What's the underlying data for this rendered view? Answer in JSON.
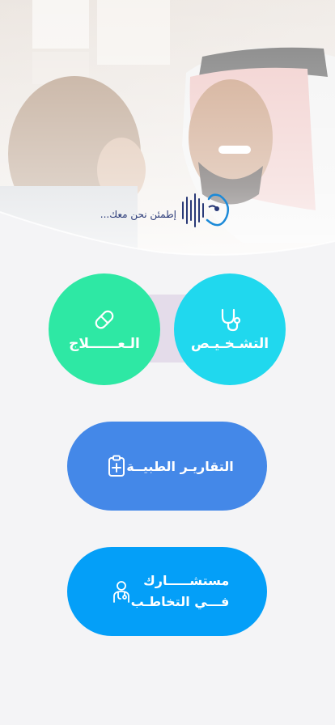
{
  "brand": {
    "tagline": "إطمئن نحن معك..."
  },
  "services": {
    "treatment": {
      "label": "الـعــــــلاج",
      "icon": "pill-icon"
    },
    "diagnosis": {
      "label": "التشـخـيـص",
      "icon": "stethoscope-icon"
    },
    "reports": {
      "label": "التقاريـر الطبيــة",
      "icon": "clipboard-plus-icon"
    },
    "consultant": {
      "line1": "مستشـــــارك",
      "line2": "فـــي التخاطـب",
      "icon": "doctor-icon"
    }
  },
  "colors": {
    "background": "#f4f4f6",
    "treatment": "#2ee8a4",
    "diagnosis": "#20d8ee",
    "reports": "#4488e8",
    "consultant": "#049ff8",
    "brand_text": "#2a3a78"
  }
}
